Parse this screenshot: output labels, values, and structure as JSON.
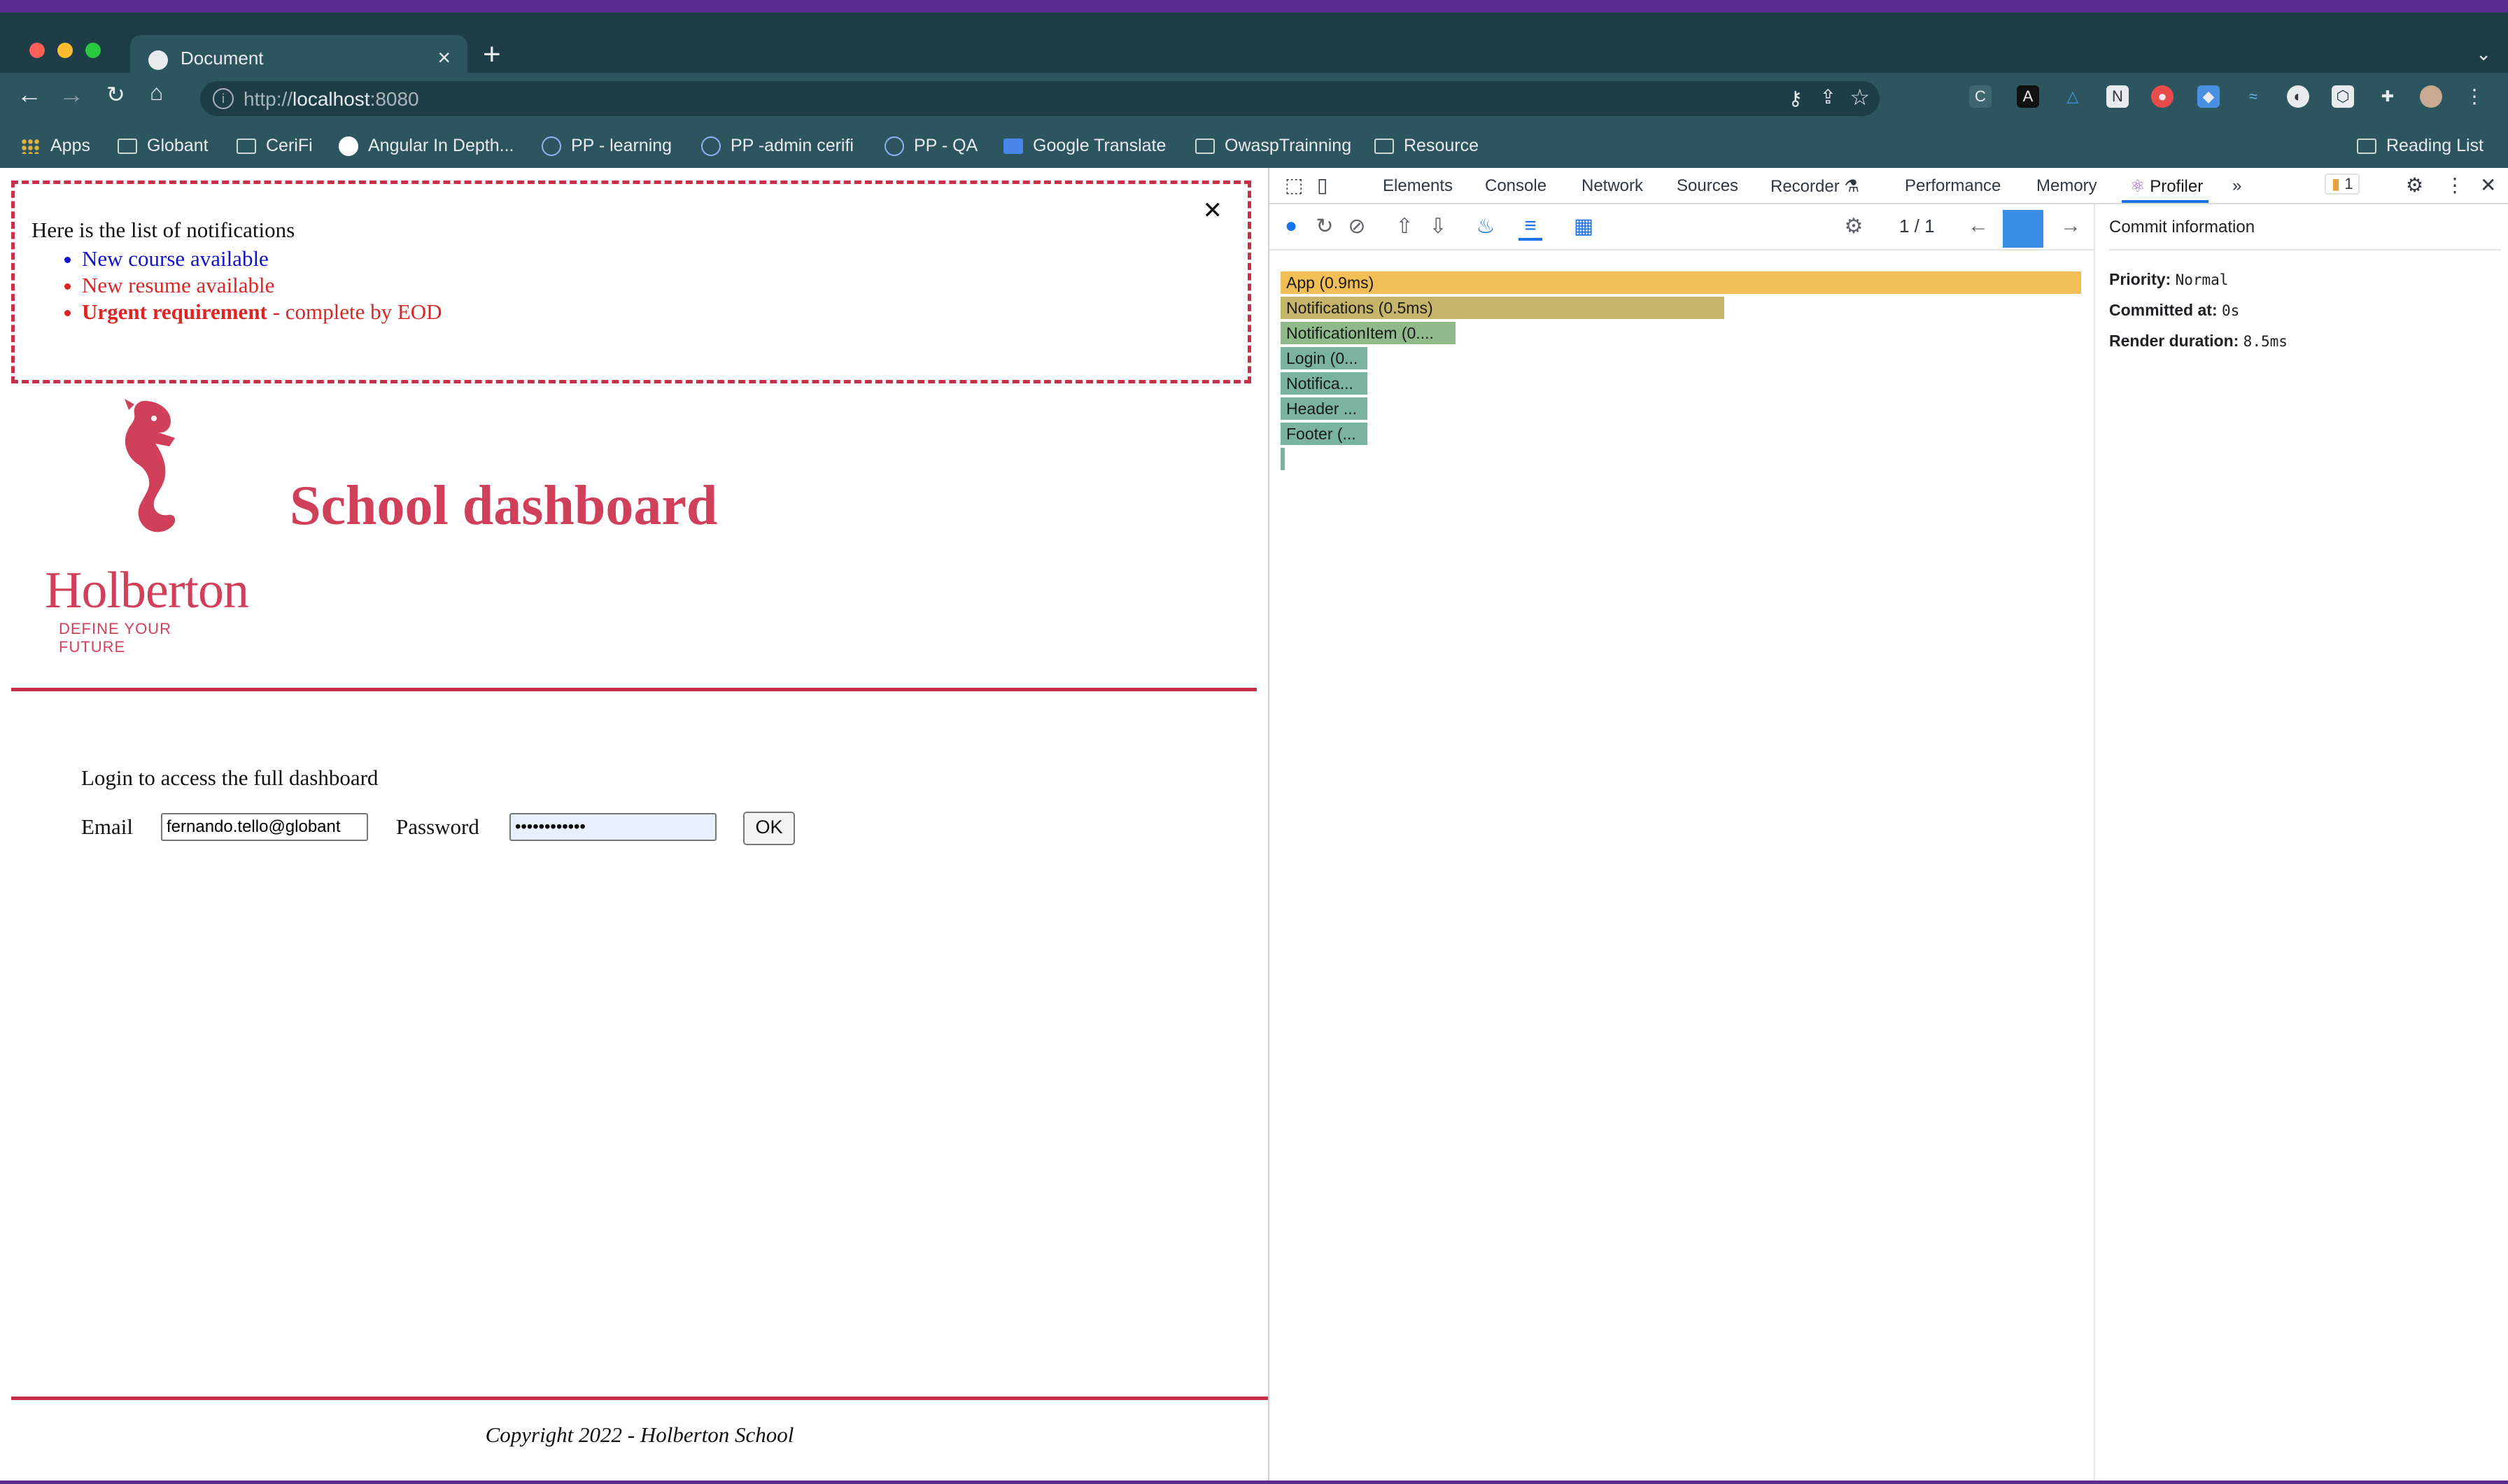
{
  "browser": {
    "tab_title": "Document",
    "url_prefix": "http://",
    "url_host": "localhost",
    "url_suffix": ":8080",
    "bookmarks": [
      "Apps",
      "Globant",
      "CeriFi",
      "Angular In Depth...",
      "PP - learning",
      "PP -admin cerifi",
      "PP - QA",
      "Google Translate",
      "OwaspTrainning",
      "Resource"
    ],
    "reading_list": "Reading List"
  },
  "page": {
    "notifications": {
      "title": "Here is the list of notifications",
      "close_symbol": "✕",
      "items": [
        {
          "text": "New course available",
          "type": "default"
        },
        {
          "text": "New resume available",
          "type": "urgent"
        },
        {
          "strong": "Urgent requirement",
          "rest": " - complete by EOD",
          "type": "urgent"
        }
      ]
    },
    "logo": {
      "word": "Holberton",
      "tagline": "DEFINE YOUR FUTURE"
    },
    "title": "School dashboard",
    "login": {
      "prompt": "Login to access the full dashboard",
      "email_label": "Email",
      "email_value": "fernando.tello@globant",
      "password_label": "Password",
      "password_value": "••••••••••••",
      "ok_label": "OK"
    },
    "footer": "Copyright 2022 - Holberton School"
  },
  "devtools": {
    "tabs": [
      "Elements",
      "Console",
      "Network",
      "Sources",
      "Recorder",
      "Performance",
      "Memory",
      "Profiler"
    ],
    "active_tab": "Profiler",
    "issues_count": "1",
    "commit_counter": "1  /  1",
    "flame": [
      {
        "label": "App (0.9ms)",
        "color": "#f2bf57"
      },
      {
        "label": "Notifications (0.5ms)",
        "color": "#c6b46a"
      },
      {
        "label": "NotificationItem (0....",
        "color": "#8fba8c"
      },
      {
        "label": "Login (0...",
        "color": "#7ab3a0"
      },
      {
        "label": "Notifica...",
        "color": "#7ab3a0"
      },
      {
        "label": "Header ...",
        "color": "#7ab3a0"
      },
      {
        "label": "Footer (...",
        "color": "#7ab3a0"
      }
    ],
    "commit_info": {
      "heading": "Commit information",
      "priority_label": "Priority:",
      "priority_value": "Normal",
      "committed_label": "Committed at:",
      "committed_value": "0s",
      "render_label": "Render duration:",
      "render_value": "8.5ms"
    }
  }
}
